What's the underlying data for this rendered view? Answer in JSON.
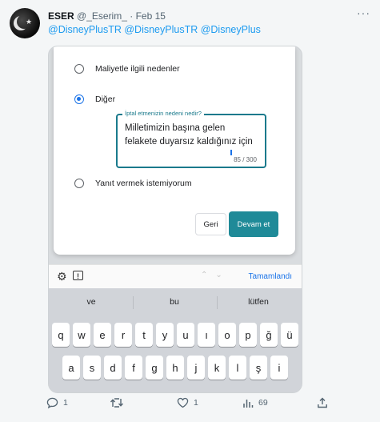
{
  "tweet": {
    "author_name": "ESER",
    "handle": "@_Eserim_",
    "separator": "·",
    "date": "Feb 15",
    "more": "···",
    "mentions": "@DisneyPlusTR @DisneyPlusTR @DisneyPlus"
  },
  "dialog": {
    "options": [
      {
        "label": "Maliyetle ilgili nedenler",
        "selected": false
      },
      {
        "label": "Diğer",
        "selected": true
      },
      {
        "label": "Yanıt vermek istemiyorum",
        "selected": false
      }
    ],
    "field_label": "İptal etmenizin nedeni nedir?",
    "field_line1": "Milletimizin başına gelen",
    "field_line2": "felakete duyarsız kaldığınız için",
    "counter": "85 / 300",
    "back_label": "Geri",
    "next_label": "Devam et"
  },
  "keyboard": {
    "done_label": "Tamamlandı",
    "suggestions": [
      "ve",
      "bu",
      "lütfen"
    ],
    "row1": [
      "q",
      "w",
      "e",
      "r",
      "t",
      "y",
      "u",
      "ı",
      "o",
      "p",
      "ğ",
      "ü"
    ],
    "row2": [
      "a",
      "s",
      "d",
      "f",
      "g",
      "h",
      "j",
      "k",
      "l",
      "ş",
      "i"
    ]
  },
  "actions": {
    "reply_count": "1",
    "retweet_count": "",
    "like_count": "1",
    "views_count": "69"
  },
  "colors": {
    "accent_teal": "#1f8a98",
    "link_blue": "#1d9bf0",
    "radio_blue": "#1a73e8"
  }
}
